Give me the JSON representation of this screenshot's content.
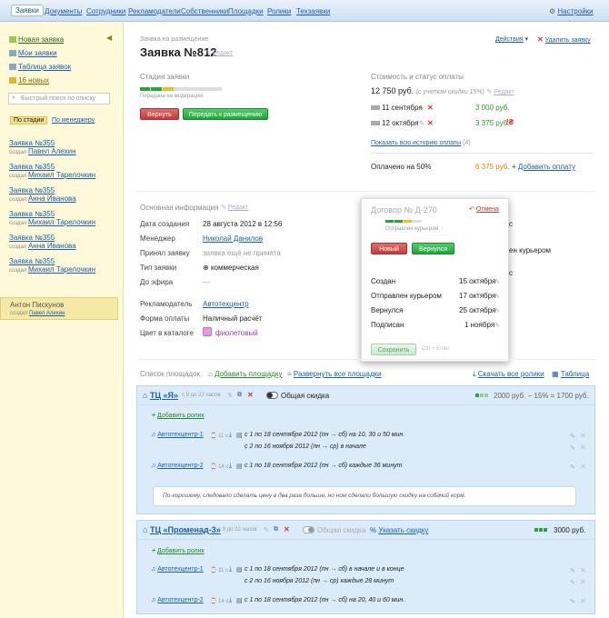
{
  "nav": {
    "tabs": [
      "Заявки",
      "Документы",
      "Сотрудники",
      "Рекламодатели",
      "Собственники",
      "Площадки",
      "Ролики",
      "Техзаявки"
    ],
    "settings": "Настройки"
  },
  "sidebar": {
    "new_request": "Новая заявка",
    "my_requests": "Мои заявки",
    "requests_table": "Таблица заявок",
    "new_count": "16 новых",
    "search_placeholder": "Быстрый поиск по списку",
    "sort_stage": "По стадии",
    "sort_manager": "По менеджеру",
    "requests": [
      {
        "title": "Заявка №355",
        "created": "создал",
        "author": "Павел Алехин"
      },
      {
        "title": "Заявка №355",
        "created": "создал",
        "author": "Михаил Тарелочкин"
      },
      {
        "title": "Заявка №355",
        "created": "создал",
        "author": "Анна Иванова"
      },
      {
        "title": "Заявка №355",
        "created": "создал",
        "author": "Михаил Тарелочкин"
      },
      {
        "title": "Заявка №355",
        "created": "создал",
        "author": "Анна Иванова"
      },
      {
        "title": "Заявка №355",
        "created": "создал",
        "author": "Михаил Тарелочкин"
      }
    ],
    "selected": {
      "name": "Антон Пискунов",
      "created": "создал",
      "author": "Павел Алехин"
    }
  },
  "header": {
    "subtitle": "Заявка на размещение",
    "title": "Заявка №812",
    "edit": "Редакт",
    "actions": "Действия",
    "delete": "Удалить заявку"
  },
  "stage": {
    "title": "Стадия заявки",
    "status": "Передана на модерацию",
    "back": "Вернуть",
    "forward": "Передать к размещению"
  },
  "payment": {
    "title": "Стоимость и статус оплаты",
    "amount": "12 750 руб.",
    "discount": "(с учетом скидки 15%)",
    "edit": "Редакт",
    "rows": [
      {
        "date": "11 сентября",
        "sum": "3 000 руб."
      },
      {
        "date": "12 октября",
        "sum": "3 375 руб."
      }
    ],
    "history": "Показать всю историю оплаты",
    "history_count": "(4)",
    "paid": "Оплачено на 50%",
    "paid_sum": "6 375 руб.",
    "add": "Добавить оплату"
  },
  "info": {
    "title": "Основная информация",
    "edit": "Редакт",
    "rows": [
      {
        "k": "Дата создания",
        "v": "28 августа 2012 в 12:56"
      },
      {
        "k": "Менеджер",
        "v": "Николай Данилов"
      },
      {
        "k": "Принял заявку",
        "v": "заявка ещё не принята"
      },
      {
        "k": "Тип заявки",
        "v": "коммерческая"
      },
      {
        "k": "До эфира",
        "v": "—"
      },
      {
        "k": "Рекламодатель",
        "v": "Автотехцентр"
      },
      {
        "k": "Форма оплаты",
        "v": "Наличный расчёт"
      },
      {
        "k": "Цвет в каталоге",
        "v": "фиолетовый"
      }
    ],
    "right_peek": [
      "с",
      "ен курьером",
      "",
      "с"
    ]
  },
  "contract": {
    "title": "Договор № Д-270",
    "cancel": "Отмена",
    "status": "Отправлен курьером",
    "new_btn": "Новый",
    "return_btn": "Вернулся",
    "rows": [
      {
        "k": "Создан",
        "v": "15 октября"
      },
      {
        "k": "Отправлен курьером",
        "v": "17 октября"
      },
      {
        "k": "Вернулся",
        "v": "25 октября"
      },
      {
        "k": "Подписан",
        "v": "1 ноября"
      }
    ],
    "save": "Сохранить",
    "hint": "Ctrl + Enter"
  },
  "places": {
    "title": "Список площадок",
    "add": "Добавить площадку",
    "expand": "Развернуть все площадки",
    "download": "Скачать все ролики",
    "table": "Таблица",
    "items": [
      {
        "name": "ТЦ «Я»",
        "hours": "с 9 до 22 часов",
        "discount_label": "Общая скидка",
        "price": "2000 руб. − 15% = 1700 руб.",
        "add_clip": "Добавить ролик",
        "clips": [
          {
            "name": "Автотехцентр-1",
            "dur": "11 с.",
            "lines": [
              "с 1 по 18 сентября 2012 (пн → сб) на 10, 30 и 50 мин.",
              "с 2 по 16 ноября 2012 (пн → ср) в начале"
            ]
          },
          {
            "name": "Автотехцентр-2",
            "dur": "14 с.",
            "lines": [
              "с 1 по 18 сентября 2012 (пн → сб) каждые 36 минут"
            ]
          }
        ],
        "comment": "По-хорошему, следовало сделать цену в два раза больше, но ном сделали большую скидку на собачий корм."
      },
      {
        "name": "ТЦ «Променад-3»",
        "hours": "с 9 до 22 часов",
        "discount_label": "Общая скидка",
        "discount_link": "Указать скидку",
        "price": "3000 руб.",
        "add_clip": "Добавить ролик",
        "clips": [
          {
            "name": "Автотехцентр-1",
            "dur": "11 с.",
            "lines": [
              "с 1 по 18 сентября 2012 (пн → сб) в начале и в конце",
              "с 2 по 16 ноября 2012 (пн → ср) каждые 28 минут"
            ]
          },
          {
            "name": "Автотехцентр-2",
            "dur": "14 с.",
            "lines": [
              "с 1 по 18 сентября 2012 (пн → сб) на 20, 40 и 60 мин."
            ]
          }
        ]
      }
    ]
  }
}
